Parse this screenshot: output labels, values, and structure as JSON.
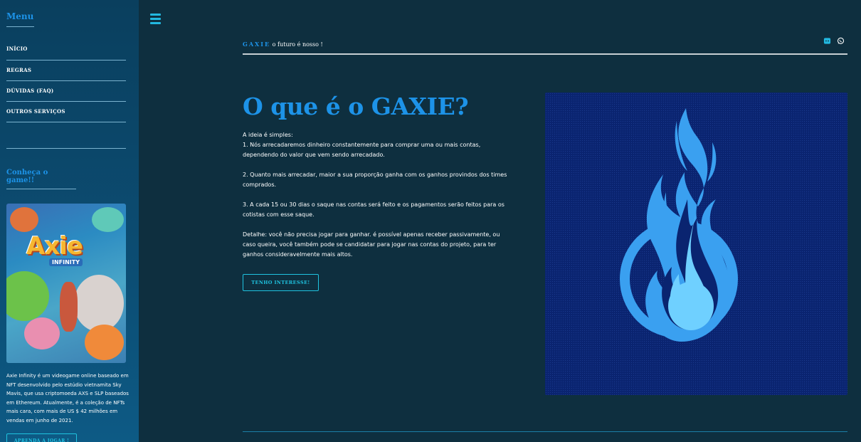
{
  "sidebar": {
    "menu_title": "Menu",
    "items": [
      {
        "label": "Início"
      },
      {
        "label": "Regras"
      },
      {
        "label": "Dúvidas (FAQ)"
      },
      {
        "label": "Outros Serviços"
      }
    ],
    "game_title": "Conheça o game!!",
    "game_image_text": "Axie",
    "game_image_subtext": "INFINITY",
    "game_description": "Axie Infinity é um videogame online baseado em NFT desenvolvido pelo estúdio vietnamita Sky Mavis, que usa criptomoeda AXS e SLP baseados em Ethereum. Atualmente, é a coleção de NFTs mais cara, com mais de US $ 42 milhões em vendas em junho de 2021.",
    "learn_button": "APRENDA A JOGAR !"
  },
  "header": {
    "brand": "GAXIE",
    "tagline": " o futuro é nosso !",
    "icons": [
      "discord-icon",
      "whatsapp-icon"
    ]
  },
  "main": {
    "title": "O que é o GAXIE?",
    "body": "A ideia é simples:\n1. Nós arrecadaremos dinheiro constantemente para comprar uma ou mais contas, dependendo do valor que vem sendo arrecadado.\n\n2. Quanto mais arrecadar, maior a sua proporção ganha com os ganhos provindos dos times comprados.\n\n3. A cada 15 ou 30 dias o saque nas contas será feito e os pagamentos serão feitos para os cotistas com esse saque.\n\nDetalhe: você não precisa jogar para ganhar. é possível apenas receber passivamente, ou caso queira, você também pode se candidatar para jogar nas contas do projeto, para ter ganhos consideravelmente mais altos.",
    "interest_button": "TENHO INTERESSE!"
  },
  "colors": {
    "accent": "#1d93e8",
    "button": "#1fc3e0",
    "background": "#0e2f3f",
    "hero_bg": "#0a2470",
    "flame_light": "#6fd0ff",
    "flame_mid": "#3aa0f0"
  }
}
